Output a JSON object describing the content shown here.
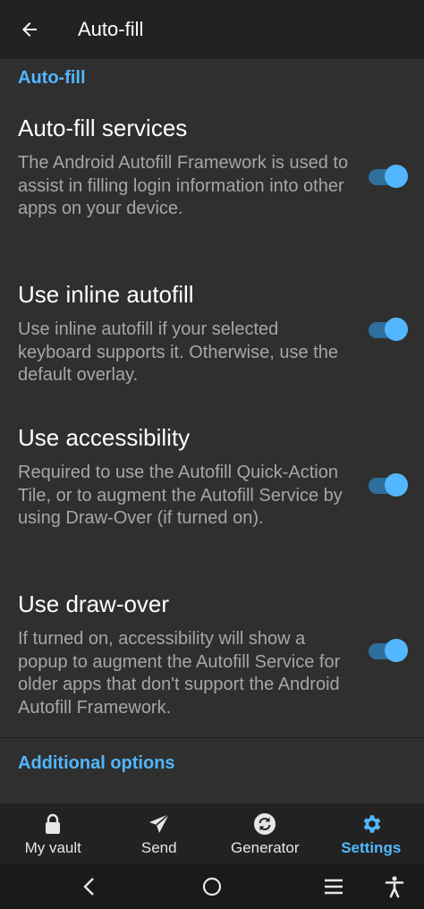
{
  "appbar": {
    "title": "Auto-fill",
    "back_icon": "arrow-left-icon"
  },
  "sections": {
    "autofill_header": "Auto-fill",
    "additional_header": "Additional options"
  },
  "items": [
    {
      "title": "Auto-fill services",
      "description": "The Android Autofill Framework is used to assist in filling login information into other apps on your device.",
      "enabled": true
    },
    {
      "title": "Use inline autofill",
      "description": "Use inline autofill if your selected keyboard supports it. Otherwise, use the default overlay.",
      "enabled": true
    },
    {
      "title": "Use accessibility",
      "description": "Required to use the Autofill Quick-Action Tile, or to augment the Autofill Service by using Draw-Over (if turned on).",
      "enabled": true
    },
    {
      "title": "Use draw-over",
      "description": "If turned on, accessibility will show a popup to augment the Autofill Service for older apps that don't support the Android Autofill Framework.",
      "enabled": true
    }
  ],
  "bottom_nav": [
    {
      "label": "My vault",
      "icon": "lock-icon",
      "active": false
    },
    {
      "label": "Send",
      "icon": "paper-plane-icon",
      "active": false
    },
    {
      "label": "Generator",
      "icon": "refresh-icon",
      "active": false
    },
    {
      "label": "Settings",
      "icon": "gear-icon",
      "active": true
    }
  ],
  "colors": {
    "accent": "#52b7ff",
    "background": "#2f2f2f",
    "appbar": "#222222",
    "text_secondary": "#a6a6a6"
  },
  "system_nav": {
    "icons": [
      "back-chevron-icon",
      "home-circle-icon",
      "recents-icon",
      "accessibility-icon"
    ]
  }
}
